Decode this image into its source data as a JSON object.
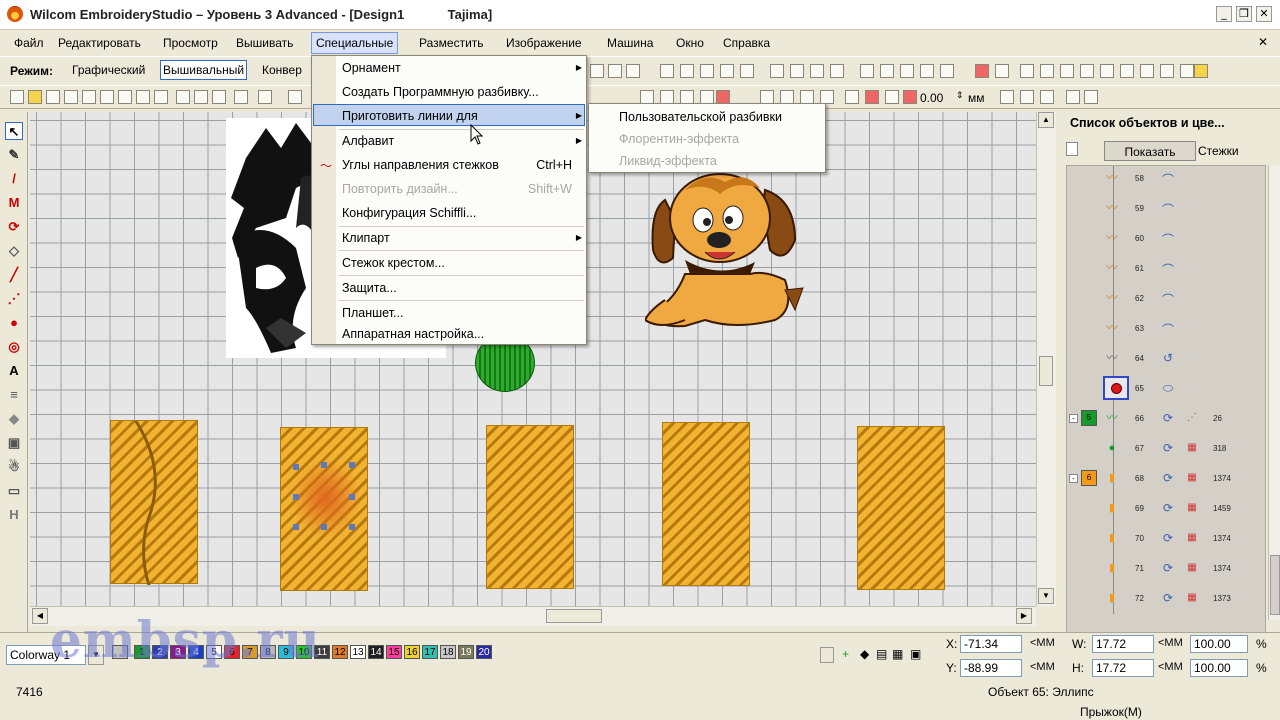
{
  "window": {
    "title": "Wilcom EmbroideryStudio – Уровень 3 Advanced - [Design1",
    "machine": "Tajima]",
    "min": "_",
    "restore": "❒",
    "close": "✕",
    "icon": "wilcom-app-icon"
  },
  "menubar": [
    "Файл",
    "Редактировать",
    "Просмотр",
    "Вышивать",
    "Специальные",
    "Разместить",
    "Изображение",
    "Машина",
    "Окно",
    "Справка"
  ],
  "modebar": {
    "label": "Режим:",
    "graphic": "Графический",
    "embroidery": "Вышивальный",
    "convert": "Конвер"
  },
  "toolbar2": {
    "value": "0.00",
    "unit": "мм"
  },
  "special_menu": {
    "items": [
      {
        "label": "Орнамент",
        "submenu": true,
        "disabled": false,
        "shortcut": ""
      },
      {
        "label": "Создать Программную разбивку...",
        "submenu": false,
        "disabled": false,
        "shortcut": ""
      },
      {
        "label": "Приготовить линии для",
        "submenu": true,
        "disabled": false,
        "shortcut": ""
      },
      {
        "label": "Алфавит",
        "submenu": true,
        "disabled": false,
        "shortcut": ""
      },
      {
        "label": "Углы направления стежков",
        "submenu": false,
        "disabled": false,
        "shortcut": "Ctrl+H"
      },
      {
        "label": "Повторить дизайн...",
        "submenu": false,
        "disabled": true,
        "shortcut": "Shift+W"
      },
      {
        "label": "Конфигурация Schiffli...",
        "submenu": false,
        "disabled": false,
        "shortcut": ""
      },
      {
        "label": "Клипарт",
        "submenu": true,
        "disabled": false,
        "shortcut": ""
      },
      {
        "label": "Стежок крестом...",
        "submenu": false,
        "disabled": false,
        "shortcut": ""
      },
      {
        "label": "Защита...",
        "submenu": false,
        "disabled": false,
        "shortcut": ""
      },
      {
        "label": "Планшет...",
        "submenu": false,
        "disabled": false,
        "shortcut": ""
      },
      {
        "label": "Аппаратная настройка...",
        "submenu": false,
        "disabled": false,
        "shortcut": ""
      }
    ],
    "highlighted_index": 2
  },
  "sub_menu": {
    "items": [
      {
        "label": "Пользовательской разбивки",
        "disabled": false
      },
      {
        "label": "Флорентин-эффекта",
        "disabled": true
      },
      {
        "label": "Ликвид-эффекта",
        "disabled": true
      }
    ]
  },
  "object_panel": {
    "title": "Список объектов и цве...",
    "show_button": "Показать",
    "stitches_tab": "Стежки",
    "rows": [
      {
        "num": "58",
        "count": "",
        "group": ""
      },
      {
        "num": "59",
        "count": "",
        "group": ""
      },
      {
        "num": "60",
        "count": "",
        "group": ""
      },
      {
        "num": "61",
        "count": "",
        "group": ""
      },
      {
        "num": "62",
        "count": "",
        "group": ""
      },
      {
        "num": "63",
        "count": "",
        "group": ""
      },
      {
        "num": "64",
        "count": "",
        "group": ""
      },
      {
        "num": "65",
        "count": "",
        "group": ""
      },
      {
        "num": "66",
        "count": "26",
        "group": "5"
      },
      {
        "num": "67",
        "count": "318",
        "group": ""
      },
      {
        "num": "68",
        "count": "1374",
        "group": "6"
      },
      {
        "num": "69",
        "count": "1459",
        "group": ""
      },
      {
        "num": "70",
        "count": "1374",
        "group": ""
      },
      {
        "num": "71",
        "count": "1374",
        "group": ""
      },
      {
        "num": "72",
        "count": "1373",
        "group": ""
      }
    ]
  },
  "colorway": {
    "label": "Colorway 1",
    "swatches": [
      "1",
      "2",
      "3",
      "4",
      "5",
      "6",
      "7",
      "8",
      "9",
      "10",
      "11",
      "12",
      "13",
      "14",
      "15",
      "16",
      "17",
      "18",
      "19",
      "20"
    ],
    "colors": [
      "#c2c2c2",
      "#1a9a2e",
      "#2e3db0",
      "#8a1a8a",
      "#1a3fc8",
      "#ffffff",
      "#e8232e",
      "#d89a2c",
      "#b8b8b8",
      "#2abfd8",
      "#28c428",
      "#3c3c3c",
      "#e07a2a",
      "#ffffff",
      "#202020",
      "#ff3ca0",
      "#f0d030",
      "#30c0b0",
      "#c8c8c8",
      "#7a7a5a",
      "#2a2aa8"
    ]
  },
  "coords": {
    "x_label": "X:",
    "x_value": "-71.34",
    "y_label": "Y:",
    "y_value": "-88.99",
    "w_label": "W:",
    "w_value": "17.72",
    "h_label": "H:",
    "h_value": "17.72",
    "unit": "<MM",
    "pct1": "100.00",
    "pct2": "100.00",
    "pct_sign": "%"
  },
  "status": {
    "stitch_count": "7416",
    "object": "Объект 65: Эллипс",
    "jump": "Прыжок(M)"
  },
  "watermark": "embsp.ru"
}
